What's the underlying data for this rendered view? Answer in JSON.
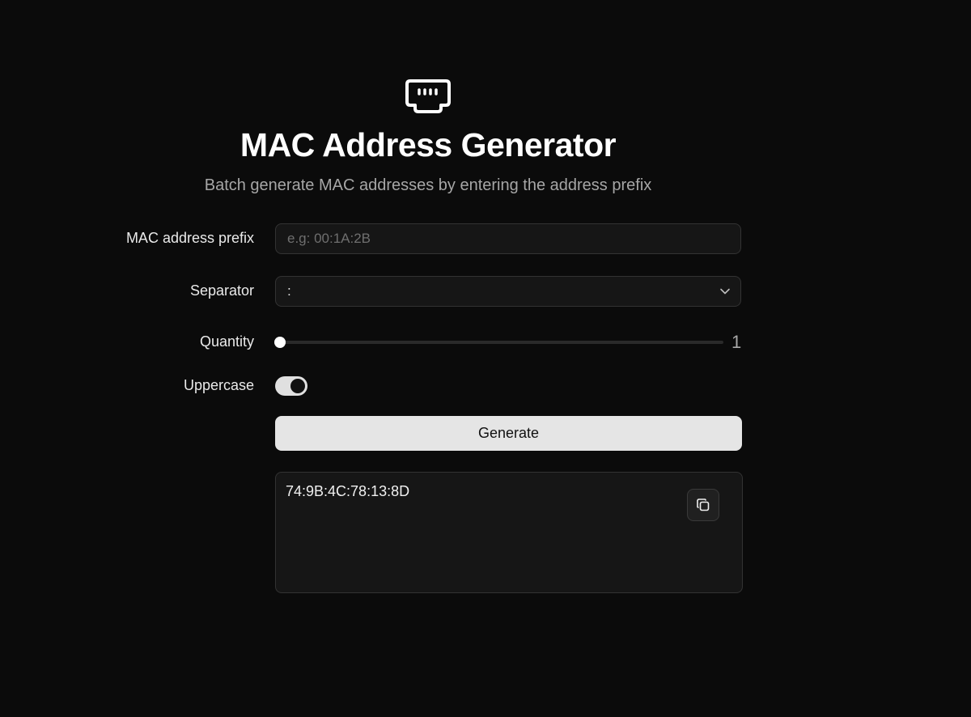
{
  "header": {
    "icon": "ethernet-port-icon",
    "title": "MAC Address Generator",
    "subtitle": "Batch generate MAC addresses by entering the address prefix"
  },
  "form": {
    "prefix": {
      "label": "MAC address prefix",
      "value": "",
      "placeholder": "e.g: 00:1A:2B"
    },
    "separator": {
      "label": "Separator",
      "value": ":",
      "icon": "chevron-down-icon"
    },
    "quantity": {
      "label": "Quantity",
      "value": "1",
      "fraction": 0
    },
    "uppercase": {
      "label": "Uppercase",
      "checked": true
    },
    "generate_label": "Generate"
  },
  "result": {
    "text": "74:9B:4C:78:13:8D",
    "copy_icon": "copy-icon"
  },
  "colors": {
    "background": "#0b0b0b",
    "panel": "#161616",
    "border": "#333333",
    "button": "#e5e5e5",
    "toggle_on": "#e0e0e0"
  }
}
